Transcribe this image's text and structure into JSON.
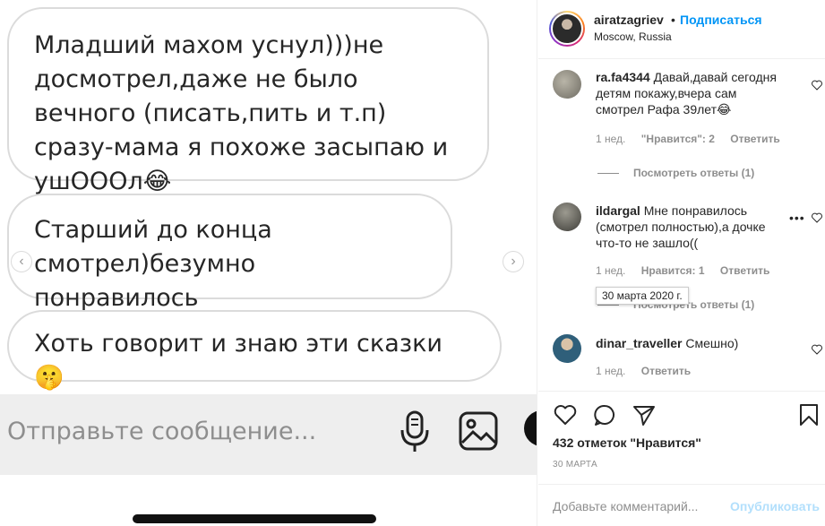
{
  "media": {
    "bubbles": [
      "Младший махом уснул)))не досмотрел,даже не было вечного (писать,пить и т.п) сразу-мама я похоже засыпаю и ушОООл😂",
      "Старший до конца смотрел)безумно понравилось",
      "Хоть говорит и знаю эти сказки 🤫"
    ],
    "message_placeholder": "Отправьте сообщение...",
    "prev_arrow": "‹",
    "next_arrow": "›"
  },
  "post_header": {
    "username": "airatzagriev",
    "separator": "•",
    "follow_label": "Подписаться",
    "location": "Moscow, Russia"
  },
  "comments": [
    {
      "user": "ra.fa4344",
      "text": "Давай,давай сегодня детям покажу,вчера сам смотрел Рафа 39лет😂",
      "time": "1 нед.",
      "likes": "\"Нравится\": 2",
      "reply": "Ответить",
      "replies": "Посмотреть ответы (1)"
    },
    {
      "user": "ildargal",
      "text": "Мне понравилось (смотрел полностью),а дочке что-то не зашло((",
      "time": "1 нед.",
      "likes": "Нравится: 1",
      "reply": "Ответить",
      "replies": "Посмотреть ответы (1)",
      "tooltip": "30 марта 2020 г.",
      "more": "•••"
    },
    {
      "user": "dinar_traveller",
      "text": "Смешно)",
      "time": "1 нед.",
      "reply": "Ответить"
    }
  ],
  "likes_count": "432 отметок \"Нравится\"",
  "post_date": "30 МАРТА",
  "add_comment": {
    "placeholder": "Добавьте комментарий...",
    "publish_label": "Опубликовать"
  },
  "colors": {
    "accent": "#0095f6",
    "muted": "#8e8e8e",
    "publish_disabled": "#b2dffc"
  }
}
